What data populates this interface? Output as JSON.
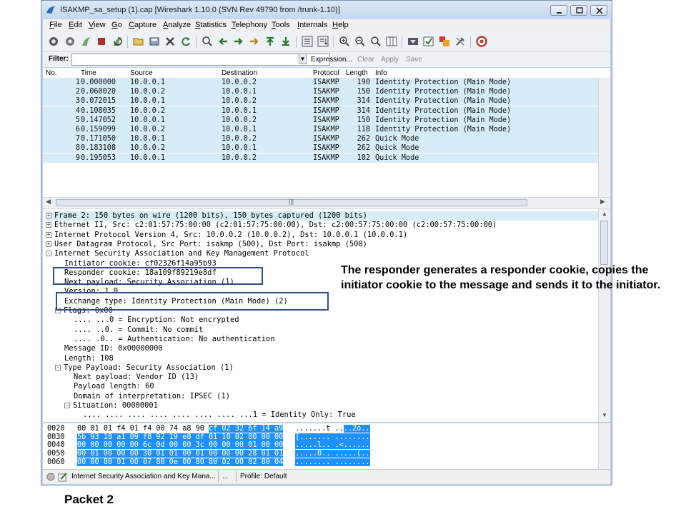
{
  "window": {
    "title": "ISAKMP_sa_setup (1).cap   [Wireshark 1.10.0  (SVN Rev 49790 from /trunk-1.10)]"
  },
  "menu": [
    "File",
    "Edit",
    "View",
    "Go",
    "Capture",
    "Analyze",
    "Statistics",
    "Telephony",
    "Tools",
    "Internals",
    "Help"
  ],
  "filter": {
    "label": "Filter:",
    "value": "",
    "expression": "Expression...",
    "clear": "Clear",
    "apply": "Apply",
    "save": "Save"
  },
  "packet_list": {
    "columns": [
      "No.",
      "Time",
      "Source",
      "Destination",
      "Protocol",
      "Length",
      "Info"
    ],
    "rows": [
      {
        "no": "1",
        "time": "0.000000",
        "src": "10.0.0.1",
        "dst": "10.0.0.2",
        "proto": "ISAKMP",
        "len": "190",
        "info": "Identity Protection (Main Mode)"
      },
      {
        "no": "2",
        "time": "0.060020",
        "src": "10.0.0.2",
        "dst": "10.0.0.1",
        "proto": "ISAKMP",
        "len": "150",
        "info": "Identity Protection (Main Mode)"
      },
      {
        "no": "3",
        "time": "0.072015",
        "src": "10.0.0.1",
        "dst": "10.0.0.2",
        "proto": "ISAKMP",
        "len": "314",
        "info": "Identity Protection (Main Mode)"
      },
      {
        "no": "4",
        "time": "0.108035",
        "src": "10.0.0.2",
        "dst": "10.0.0.1",
        "proto": "ISAKMP",
        "len": "314",
        "info": "Identity Protection (Main Mode)"
      },
      {
        "no": "5",
        "time": "0.147052",
        "src": "10.0.0.1",
        "dst": "10.0.0.2",
        "proto": "ISAKMP",
        "len": "150",
        "info": "Identity Protection (Main Mode)"
      },
      {
        "no": "6",
        "time": "0.159099",
        "src": "10.0.0.2",
        "dst": "10.0.0.1",
        "proto": "ISAKMP",
        "len": "118",
        "info": "Identity Protection (Main Mode)"
      },
      {
        "no": "7",
        "time": "0.171050",
        "src": "10.0.0.1",
        "dst": "10.0.0.2",
        "proto": "ISAKMP",
        "len": "262",
        "info": "Quick Mode"
      },
      {
        "no": "8",
        "time": "0.183108",
        "src": "10.0.0.2",
        "dst": "10.0.0.1",
        "proto": "ISAKMP",
        "len": "262",
        "info": "Quick Mode"
      },
      {
        "no": "9",
        "time": "0.195053",
        "src": "10.0.0.1",
        "dst": "10.0.0.2",
        "proto": "ISAKMP",
        "len": "102",
        "info": "Quick Mode"
      }
    ]
  },
  "details": [
    {
      "toggle": "+",
      "text": "Frame 2: 150 bytes on wire (1200 bits), 150 bytes captured (1200 bits)"
    },
    {
      "toggle": "+",
      "text": "Ethernet II, Src: c2:01:57:75:00:00 (c2:01:57:75:00:00), Dst: c2:00:57:75:00:00 (c2:00:57:75:00:00)"
    },
    {
      "toggle": "+",
      "text": "Internet Protocol Version 4, Src: 10.0.0.2 (10.0.0.2), Dst: 10.0.0.1 (10.0.0.1)"
    },
    {
      "toggle": "+",
      "text": "User Datagram Protocol, Src Port: isakmp (500), Dst Port: isakmp (500)"
    },
    {
      "toggle": "-",
      "text": "Internet Security Association and Key Management Protocol"
    },
    {
      "toggle": "",
      "text": "Initiator cookie: cf02326f14a95b93"
    },
    {
      "toggle": "",
      "text": "Responder cookie: 18a109f89219e8df"
    },
    {
      "toggle": "",
      "text": "Next payload: Security Association (1)"
    },
    {
      "toggle": "",
      "text": "Version: 1.0"
    },
    {
      "toggle": "",
      "text": "Exchange type: Identity Protection (Main Mode) (2)"
    },
    {
      "toggle": "-",
      "text": "Flags: 0x00"
    },
    {
      "toggle": "",
      "text": ".... ...0 = Encryption: Not encrypted"
    },
    {
      "toggle": "",
      "text": ".... ..0. = Commit: No commit"
    },
    {
      "toggle": "",
      "text": ".... .0.. = Authentication: No authentication"
    },
    {
      "toggle": "",
      "text": "Message ID: 0x00000000"
    },
    {
      "toggle": "",
      "text": "Length: 108"
    },
    {
      "toggle": "-",
      "text": "Type Payload: Security Association (1)"
    },
    {
      "toggle": "",
      "text": "Next payload: Vendor ID (13)"
    },
    {
      "toggle": "",
      "text": "Payload length: 60"
    },
    {
      "toggle": "",
      "text": "Domain of interpretation: IPSEC (1)"
    },
    {
      "toggle": "-",
      "text": "Situation: 00000001"
    },
    {
      "toggle": "",
      "text": ".... .... .... .... .... .... .... ...1 = Identity Only: True"
    }
  ],
  "hex": [
    {
      "offset": "0020",
      "plain": "00 01 01 f4 01 f4 00 74  a8 90 ",
      "hl": "cf 02 32 6f 14 a9",
      "ascii_plain": ".......t ..",
      "ascii_hl": "..2o.."
    },
    {
      "offset": "0030",
      "plain": "",
      "hl": "5b 93 18 a1 09 f8 92 19  e8 df 01 10 02 00 00 00",
      "ascii_plain": "",
      "ascii_hl": "[....... ........"
    },
    {
      "offset": "0040",
      "plain": "",
      "hl": "00 00 00 00 00 6c 0d 00  00 3c 00 00 00 01 00 00",
      "ascii_plain": "",
      "ascii_hl": ".....l.. .<......"
    },
    {
      "offset": "0050",
      "plain": "",
      "hl": "00 01 00 00 00 30 01 01  00 01 00 00 00 28 01 01",
      "ascii_plain": "",
      "ascii_hl": ".....0.. .....(.."
    },
    {
      "offset": "0060",
      "plain": "",
      "hl": "00 00 80 01 00 07 80 0e  00 80 80 02 00 02 80 04",
      "ascii_plain": "",
      "ascii_hl": "........ ........"
    }
  ],
  "status": {
    "field": "Internet Security Association and Key Mana...",
    "extra": "...",
    "profile": "Profile: Default"
  },
  "note": "The responder generates a responder cookie, copies the initiator cookie to the message and sends it to the initiator.",
  "caption": "Packet 2"
}
